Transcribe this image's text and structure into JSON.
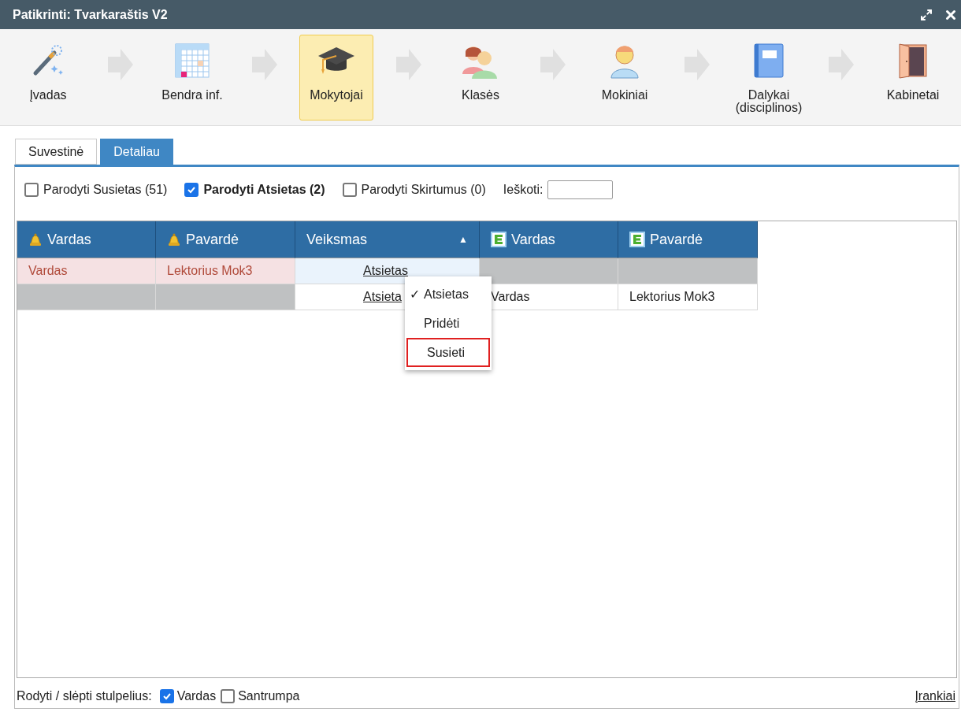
{
  "window": {
    "title": "Patikrinti: Tvarkaraštis V2"
  },
  "steps": [
    {
      "label": "Įvadas",
      "selected": false
    },
    {
      "label": "Bendra inf.",
      "selected": false
    },
    {
      "label": "Mokytojai",
      "selected": true
    },
    {
      "label": "Klasės",
      "selected": false
    },
    {
      "label": "Mokiniai",
      "selected": false
    },
    {
      "label": "Dalykai (disciplinos)",
      "selected": false
    },
    {
      "label": "Kabinetai",
      "selected": false
    }
  ],
  "tabs": [
    {
      "label": "Suvestinė",
      "selected": false
    },
    {
      "label": "Detaliau",
      "selected": true
    }
  ],
  "filters": [
    {
      "label": "Parodyti Susietas (51)",
      "checked": false
    },
    {
      "label": "Parodyti Atsietas (2)",
      "checked": true
    },
    {
      "label": "Parodyti Skirtumus (0)",
      "checked": false
    }
  ],
  "search": {
    "label": "Ieškoti:"
  },
  "table": {
    "columns": [
      {
        "label": "Vardas",
        "kind": "source"
      },
      {
        "label": "Pavardė",
        "kind": "source"
      },
      {
        "label": "Veiksmas",
        "kind": "action",
        "sort": "▲"
      },
      {
        "label": "Vardas",
        "kind": "target"
      },
      {
        "label": "Pavardė",
        "kind": "target"
      }
    ],
    "rows": [
      {
        "cells": [
          {
            "kind": "mismatch",
            "text": "Vardas"
          },
          {
            "kind": "mismatch",
            "text": "Lektorius Mok3"
          },
          {
            "kind": "action",
            "text": "Atsietas",
            "selected": true
          },
          {
            "kind": "empty"
          },
          {
            "kind": "empty"
          }
        ]
      },
      {
        "cells": [
          {
            "kind": "empty"
          },
          {
            "kind": "empty"
          },
          {
            "kind": "action",
            "text": "Atsieta",
            "selected": false
          },
          {
            "kind": "plain",
            "text": "Vardas"
          },
          {
            "kind": "plain",
            "text": "Lektorius Mok3"
          }
        ]
      }
    ]
  },
  "menu": {
    "check_mark": "✓",
    "items": [
      {
        "label": "Atsietas",
        "checked": true,
        "outlined": false
      },
      {
        "label": "Pridėti",
        "checked": false,
        "outlined": false
      },
      {
        "label": "Susieti",
        "checked": false,
        "outlined": true
      }
    ]
  },
  "footer": {
    "label": "Rodyti / slėpti stulpelius:",
    "options": [
      {
        "label": "Vardas",
        "checked": true
      },
      {
        "label": "Santrumpa",
        "checked": false
      }
    ],
    "link": "Įrankiai"
  }
}
